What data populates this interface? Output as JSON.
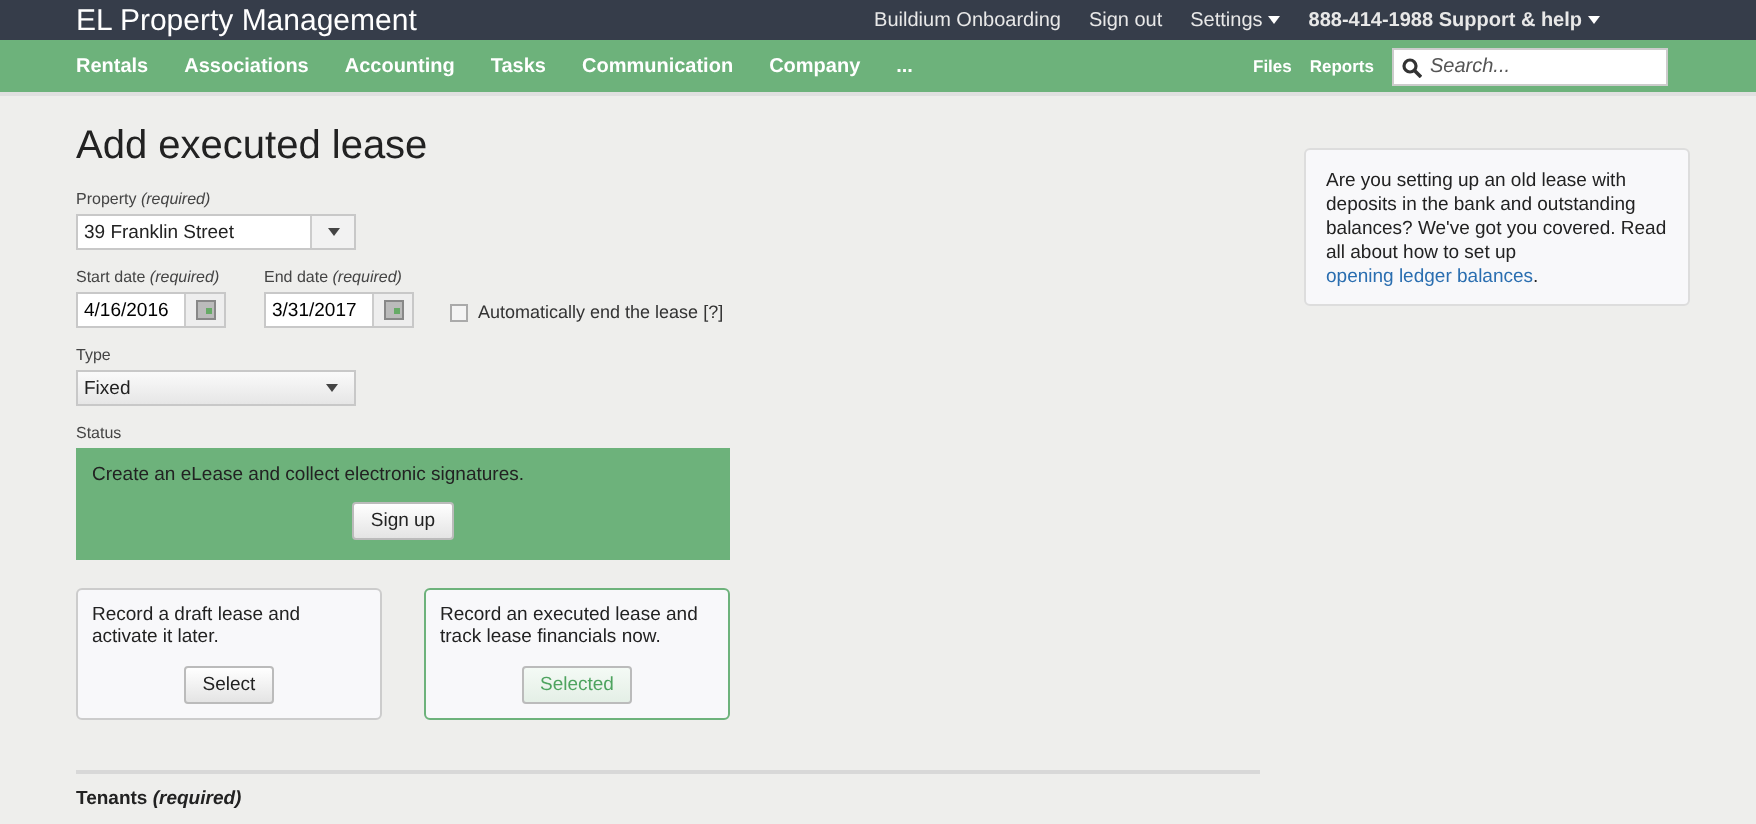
{
  "header": {
    "title": "EL Property Management",
    "links": [
      {
        "label": "Buildium Onboarding",
        "menu": false
      },
      {
        "label": "Sign out",
        "menu": false
      },
      {
        "label": "Settings",
        "menu": true
      },
      {
        "label": "888-414-1988 Support & help",
        "menu": true
      }
    ]
  },
  "nav": {
    "items": [
      "Rentals",
      "Associations",
      "Accounting",
      "Tasks",
      "Communication",
      "Company",
      "..."
    ],
    "right_links": [
      "Files",
      "Reports"
    ],
    "search": {
      "placeholder": "Search..."
    }
  },
  "page": {
    "title": "Add executed lease",
    "property": {
      "label": "Property",
      "hint": "(required)",
      "value": "39 Franklin Street"
    },
    "start_date": {
      "label": "Start date",
      "hint": "(required)",
      "value": "4/16/2016"
    },
    "end_date": {
      "label": "End date",
      "hint": "(required)",
      "value": "3/31/2017"
    },
    "auto_end": {
      "label": "Automatically end the lease [?]",
      "checked": false
    },
    "type": {
      "label": "Type",
      "value": "Fixed"
    },
    "status": {
      "label": "Status",
      "promo": {
        "text": "Create an eLease and collect electronic signatures.",
        "button": "Sign up"
      },
      "options": [
        {
          "text": "Record a draft lease and activate it later.",
          "button": "Select",
          "selected": false
        },
        {
          "text": "Record an executed lease and track lease financials now.",
          "button": "Selected",
          "selected": true
        }
      ]
    },
    "tenants": {
      "label": "Tenants",
      "hint": "(required)"
    }
  },
  "help": {
    "text": "Are you setting up an old lease with deposits in the bank and outstanding balances? We've got you covered. Read all about how to set up ",
    "link": "opening ledger balances",
    "after": "."
  }
}
